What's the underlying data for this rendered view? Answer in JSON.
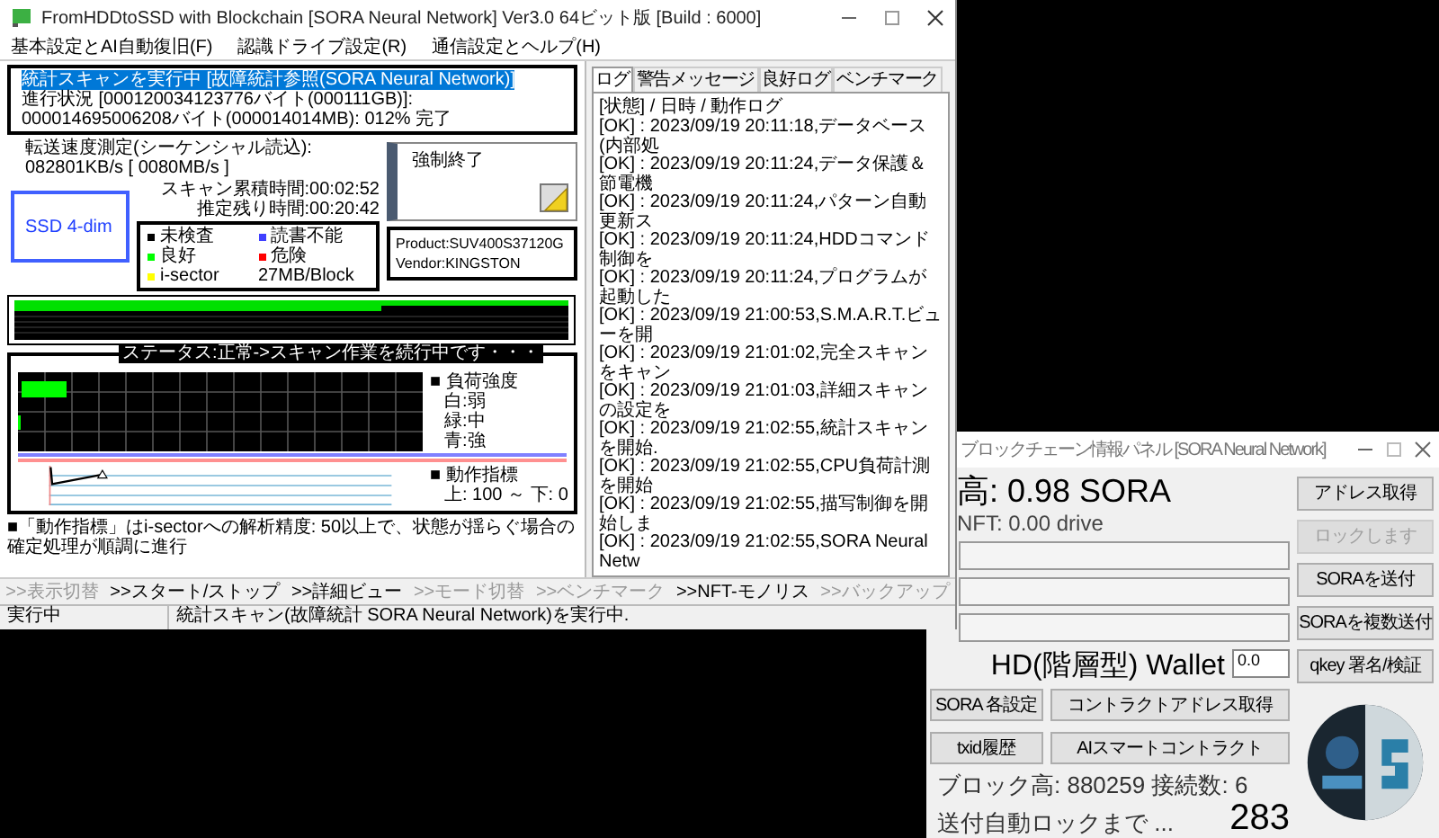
{
  "main_window": {
    "title": "FromHDDtoSSD with Blockchain [SORA Neural Network] Ver3.0 64ビット版 [Build : 6000]",
    "menu": [
      "基本設定とAI自動復旧(F)",
      "認識ドライブ設定(R)",
      "通信設定とヘルプ(H)"
    ],
    "scan_status": {
      "headline": "統計スキャンを実行中 [故障統計参照(SORA Neural Network)]",
      "highlighted": true,
      "progress": "進行状況 [000120034123776バイト(000111GB)]: 000014695006208バイト(000014014MB): 012% 完了"
    },
    "transfer_speed": "転送速度測定(シーケンシャル読込): 082801KB/s [ 0080MB/s ]",
    "elapsed_time": "スキャン累積時間:00:02:52",
    "remaining_time": "推定残り時間:00:20:42",
    "drive_view": "SSD 4-dim",
    "legend": {
      "items": [
        {
          "label": "未検査",
          "color": "#000000"
        },
        {
          "label": "読書不能",
          "color": "#4040ff"
        },
        {
          "label": "良好",
          "color": "#00ff00"
        },
        {
          "label": "危険",
          "color": "#ff0000"
        },
        {
          "label": "i-sector",
          "color": "#ffff00"
        }
      ],
      "block_size": "27MB/Block"
    },
    "force_stop_button": "強制終了",
    "device": {
      "product": "Product:SUV400S37120G",
      "vendor": "Vendor:KINGSTON"
    },
    "status_message": "ステータス:正常->スキャン作業を続行中です・・・",
    "load_legend": {
      "title": "■ 負荷強度",
      "items": [
        "白:弱",
        "緑:中",
        "青:強"
      ]
    },
    "indicator_legend": {
      "title": "■ 動作指標",
      "range": "上: 100 ～ 下: 0"
    },
    "note": "■「動作指標」はi-sectorへの解析精度: 50以上で、状態が揺らぐ場合の確定処理が順調に進行",
    "tabs": [
      {
        "label": "ログ",
        "selected": true
      },
      {
        "label": "警告メッセージ",
        "selected": false
      },
      {
        "label": "良好ログ",
        "selected": false
      },
      {
        "label": "ベンチマーク",
        "selected": false
      }
    ],
    "log": {
      "header": "[状態] / 日時 / 動作ログ",
      "entries": [
        "[OK] : 2023/09/19 20:11:18,データベース(内部処",
        "[OK] : 2023/09/19 20:11:24,データ保護＆節電機",
        "[OK] : 2023/09/19 20:11:24,パターン自動更新ス",
        "[OK] : 2023/09/19 20:11:24,HDDコマンド制御を",
        "[OK] : 2023/09/19 20:11:24,プログラムが起動した",
        "[OK] : 2023/09/19 21:00:53,S.M.A.R.T.ビューを開",
        "[OK] : 2023/09/19 21:01:02,完全スキャンをキャン",
        "[OK] : 2023/09/19 21:01:03,詳細スキャンの設定を",
        "[OK] : 2023/09/19 21:02:55,統計スキャンを開始.",
        "[OK] : 2023/09/19 21:02:55,CPU負荷計測を開始",
        "[OK] : 2023/09/19 21:02:55,描写制御を開始しま",
        "[OK] : 2023/09/19 21:02:55,SORA Neural Netw"
      ]
    },
    "toolbar": [
      {
        "label": ">>表示切替",
        "disabled": true
      },
      {
        "label": ">>スタート/ストップ",
        "disabled": false
      },
      {
        "label": ">>詳細ビュー",
        "disabled": false
      },
      {
        "label": ">>モード切替",
        "disabled": true
      },
      {
        "label": ">>ベンチマーク",
        "disabled": true
      },
      {
        "label": ">>NFT-モノリス",
        "disabled": false
      },
      {
        "label": ">>バックアップ",
        "disabled": true
      }
    ],
    "status_bar": [
      "実行中",
      "統計スキャン(故障統計 SORA Neural Network)を実行中."
    ]
  },
  "wallet_window": {
    "title": "ブロックチェーン情報パネル [SORA Neural Network]",
    "balance": "高: 0.98 SORA",
    "nft": "NFT: 0.00 drive",
    "wallet_label": "HD(階層型) Wallet",
    "amount": "0.0",
    "side_buttons": [
      {
        "label": "アドレス取得",
        "disabled": false
      },
      {
        "label": "ロックします",
        "disabled": true
      },
      {
        "label": "SORAを送付",
        "disabled": false
      },
      {
        "label": "SORAを複数送付",
        "disabled": false
      },
      {
        "label": "qkey 署名/検証",
        "disabled": false
      }
    ],
    "buttons": [
      "SORA 各設定",
      "コントラクトアドレス取得",
      "txid履歴",
      "AIスマートコントラクト"
    ],
    "block_info": "ブロック高: 880259 接続数: 6",
    "lock_text": "送付自動ロックまで ...",
    "countdown": "283"
  }
}
